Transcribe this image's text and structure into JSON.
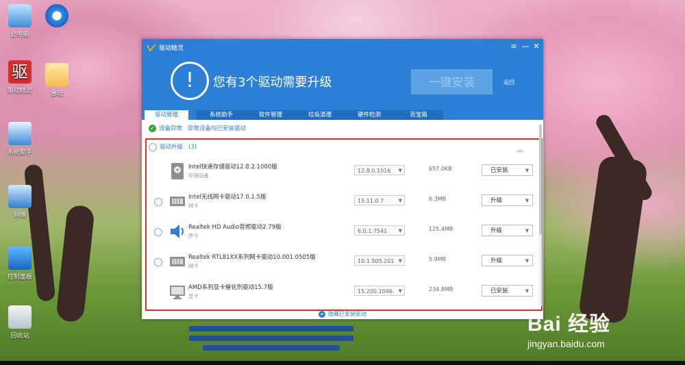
{
  "desktop": {
    "icons": [
      {
        "label": "此电脑",
        "icon": "computer-icon"
      },
      {
        "label": "",
        "icon": "internet-explorer-icon"
      },
      {
        "label": "驱动精灵",
        "icon": "driver-genius-icon"
      },
      {
        "label": "鲁班",
        "icon": "folder-icon"
      },
      {
        "label": "系统助手",
        "icon": "system-assistant-icon"
      },
      {
        "label": "网络",
        "icon": "network-icon"
      },
      {
        "label": "控制面板",
        "icon": "control-panel-icon"
      },
      {
        "label": "回收站",
        "icon": "recycle-bin-icon"
      }
    ],
    "watermark": {
      "brand": "Bai 经验",
      "url": "jingyan.baidu.com"
    }
  },
  "annotation": {
    "text": "驱动",
    "color": "#e0312b"
  },
  "window": {
    "title": "驱动精灵",
    "controls": [
      "≡",
      "—",
      "✕"
    ],
    "headline": "您有3个驱动需要升级",
    "install_all": "一键安装",
    "back": "返回",
    "tabs": [
      "驱动管理",
      "系统助手",
      "软件管理",
      "垃圾清理",
      "硬件检测",
      "百宝箱"
    ],
    "active_tab": "驱动管理",
    "status": {
      "label": "设备异常",
      "detail": "异常设备均已安装驱动"
    },
    "group": {
      "label": "驱动升级",
      "count": "(3)"
    },
    "drivers": [
      {
        "name": "Intel快速存储驱动12.8.2.1000版",
        "category": "存储设备",
        "version": "12.8.0.1016",
        "size": "657.0KB",
        "action": "已安装",
        "selectable": false,
        "icon": "storage-icon"
      },
      {
        "name": "Intel无线网卡驱动17.0.1.5版",
        "category": "网卡",
        "version": "15.11.0.7",
        "size": "6.3MB",
        "action": "升级",
        "selectable": true,
        "icon": "network-card-icon"
      },
      {
        "name": "Realtek HD Audio音频驱动2.79版",
        "category": "声卡",
        "version": "6.0.1.7541",
        "size": "125.4MB",
        "action": "升级",
        "selectable": true,
        "icon": "speaker-icon"
      },
      {
        "name": "Realtek RTL81XX系列网卡驱动10.001.0505版",
        "category": "网卡",
        "version": "10.1.505.201",
        "size": "5.9MB",
        "action": "升级",
        "selectable": true,
        "icon": "network-card-icon"
      },
      {
        "name": "AMD系列显卡催化剂驱动15.7版",
        "category": "显卡",
        "version": "15.200.1046.",
        "size": "234.8MB",
        "action": "已安装",
        "selectable": false,
        "icon": "monitor-icon"
      }
    ],
    "footer": "隐藏已安装驱动",
    "colors": {
      "header": "#2b7fd4",
      "frame": "#e0312b"
    }
  }
}
